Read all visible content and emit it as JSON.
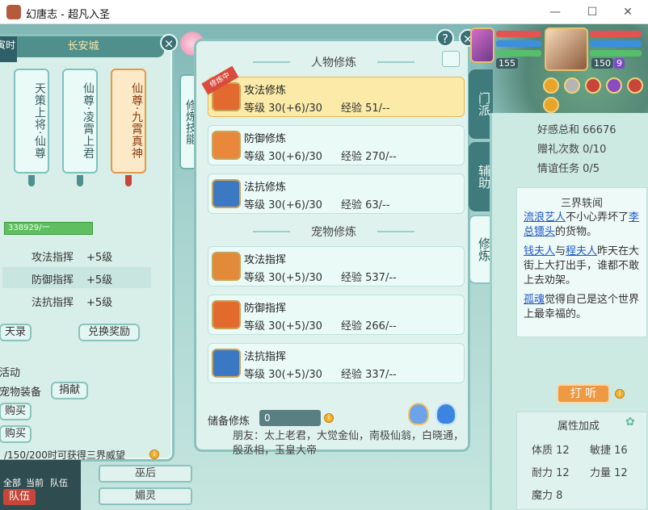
{
  "window": {
    "title": "幻唐志 - 超凡入圣",
    "min": "—",
    "max": "☐",
    "close": "✕"
  },
  "left_panel": {
    "city": "长安城",
    "time_chip": "寅时",
    "scrolls": [
      "天策上将·仙尊",
      "仙尊·凌霄上君",
      "仙尊·九霄真神"
    ],
    "progress": "338929/一",
    "rows": [
      {
        "name": "攻法指挥",
        "value": "+5级"
      },
      {
        "name": "防御指挥",
        "value": "+5级"
      },
      {
        "name": "法抗指挥",
        "value": "+5级"
      }
    ],
    "btn_left": "天录",
    "btn_redeem": "兑换奖励",
    "text_activity": "活动",
    "text_pet_equip": "宠物装备",
    "btn_donate": "捐献",
    "btn_buy1": "购买",
    "btn_buy2": "购买",
    "reputation_text": "/150/200时可获得三界威望",
    "bottom": {
      "all": "全部",
      "current": "当前",
      "team": "队伍",
      "team_btn": "队伍"
    },
    "name_btns": [
      "巫后",
      "媚灵"
    ]
  },
  "vertical_tab": "修炼技能",
  "center_panel": {
    "person_header": "人物修炼",
    "pet_header": "宠物修炼",
    "ribbon": "修炼中",
    "person": [
      {
        "name": "攻法修炼",
        "level": "等级 30(+6)/30",
        "exp": "经验 51/--"
      },
      {
        "name": "防御修炼",
        "level": "等级 30(+6)/30",
        "exp": "经验 270/--"
      },
      {
        "name": "法抗修炼",
        "level": "等级 30(+6)/30",
        "exp": "经验 63/--"
      }
    ],
    "pet": [
      {
        "name": "攻法指挥",
        "level": "等级 30(+5)/30",
        "exp": "经验 537/--"
      },
      {
        "name": "防御指挥",
        "level": "等级 30(+5)/30",
        "exp": "经验 266/--"
      },
      {
        "name": "法抗指挥",
        "level": "等级 30(+5)/30",
        "exp": "经验 337/--"
      }
    ],
    "reserve_label": "储备修炼",
    "reserve_value": "0"
  },
  "right_tabs": [
    "门派",
    "辅助",
    "修炼"
  ],
  "right_panel": {
    "stats": [
      {
        "label": "好感总和",
        "value": "66676"
      },
      {
        "label": "赠礼次数",
        "value": "0/10"
      },
      {
        "label": "情谊任务",
        "value": "0/5"
      }
    ],
    "news_header": "三界轶闻",
    "news": [
      {
        "lnk1": "流浪艺人",
        "t1": "不小心弄坏了",
        "lnk2": "李总镖头",
        "t2": "的货物。"
      },
      {
        "lnk1": "钱夫人",
        "t1": "与",
        "lnk2": "程夫人",
        "t2": "昨天在大街上大打出手，谁都不敢上去劝架。"
      },
      {
        "lnk1": "孤魂",
        "t1": "觉得自己是这个世界上最幸福的。",
        "lnk2": "",
        "t2": ""
      }
    ],
    "listen_btn": "打 听",
    "attr_header": "属性加成",
    "attrs": [
      {
        "n": "体质",
        "v": "12"
      },
      {
        "n": "敏捷",
        "v": "16"
      },
      {
        "n": "耐力",
        "v": "12"
      },
      {
        "n": "力量",
        "v": "12"
      },
      {
        "n": "魔力",
        "v": "8"
      }
    ]
  },
  "bottom_text": "朋友：太上老君，大觉金仙，南极仙翁，白晓通，殷丞相，玉皇大帝",
  "hud": {
    "pet_level": "155",
    "player_level": "150",
    "badge": "9"
  },
  "colors": {
    "accent": "#8cc2bd",
    "selected": "#fbeaa8",
    "link": "#1d57c9",
    "progress": "#5fbf60"
  }
}
